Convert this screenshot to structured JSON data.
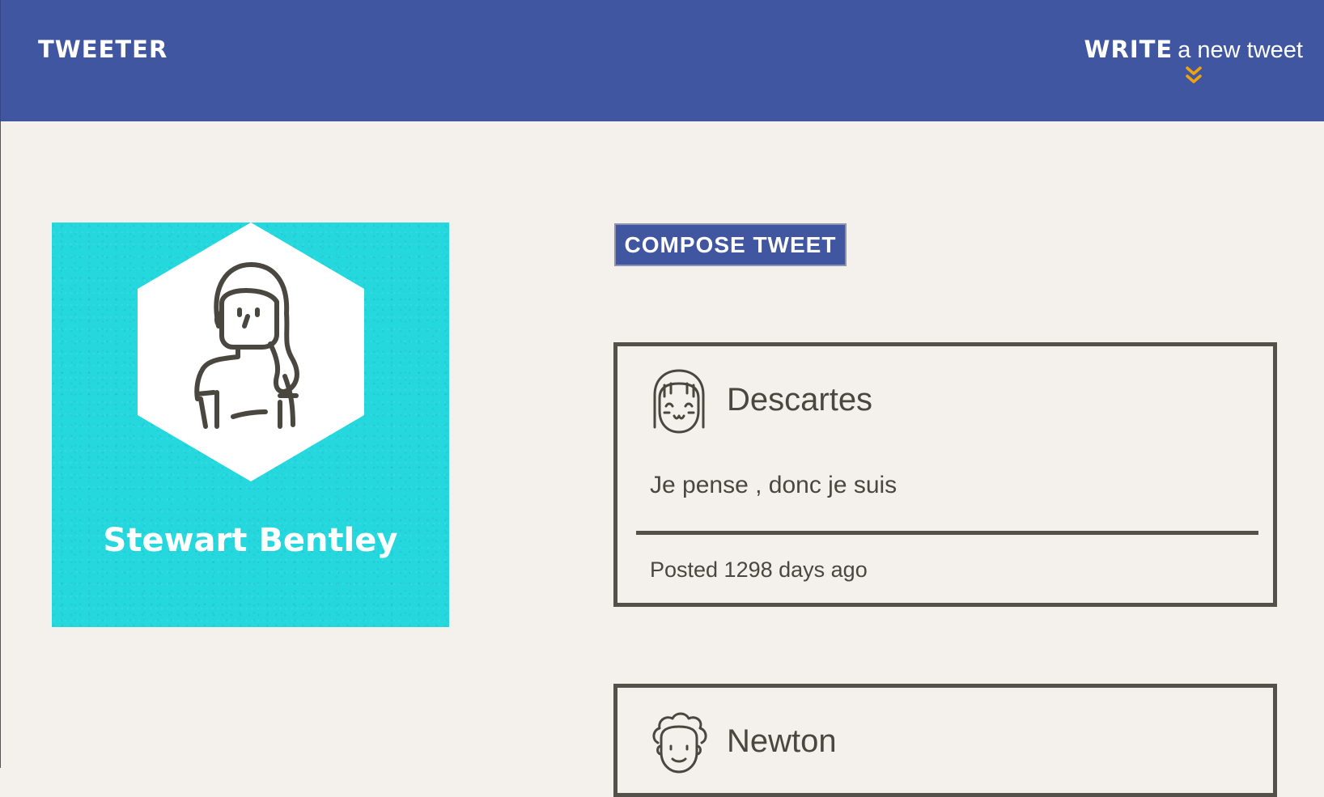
{
  "navbar": {
    "brand": "TWEETER",
    "write_bold": "WRITE",
    "write_rest": "a new tweet",
    "write_icon": "double-chevron-down-icon",
    "accent": "#f0a30a",
    "background": "#4056a1"
  },
  "profile": {
    "name": "Stewart Bentley",
    "background": "#24d8de"
  },
  "compose": {
    "label": "COMPOSE TWEET"
  },
  "tweets": [
    {
      "author": "Descartes",
      "content": "Je pense , donc je suis",
      "posted": "Posted 1298 days ago",
      "avatar_icon": "smiling-girl-avatar-icon"
    },
    {
      "author": "Newton",
      "avatar_icon": "curly-hair-avatar-icon"
    }
  ]
}
